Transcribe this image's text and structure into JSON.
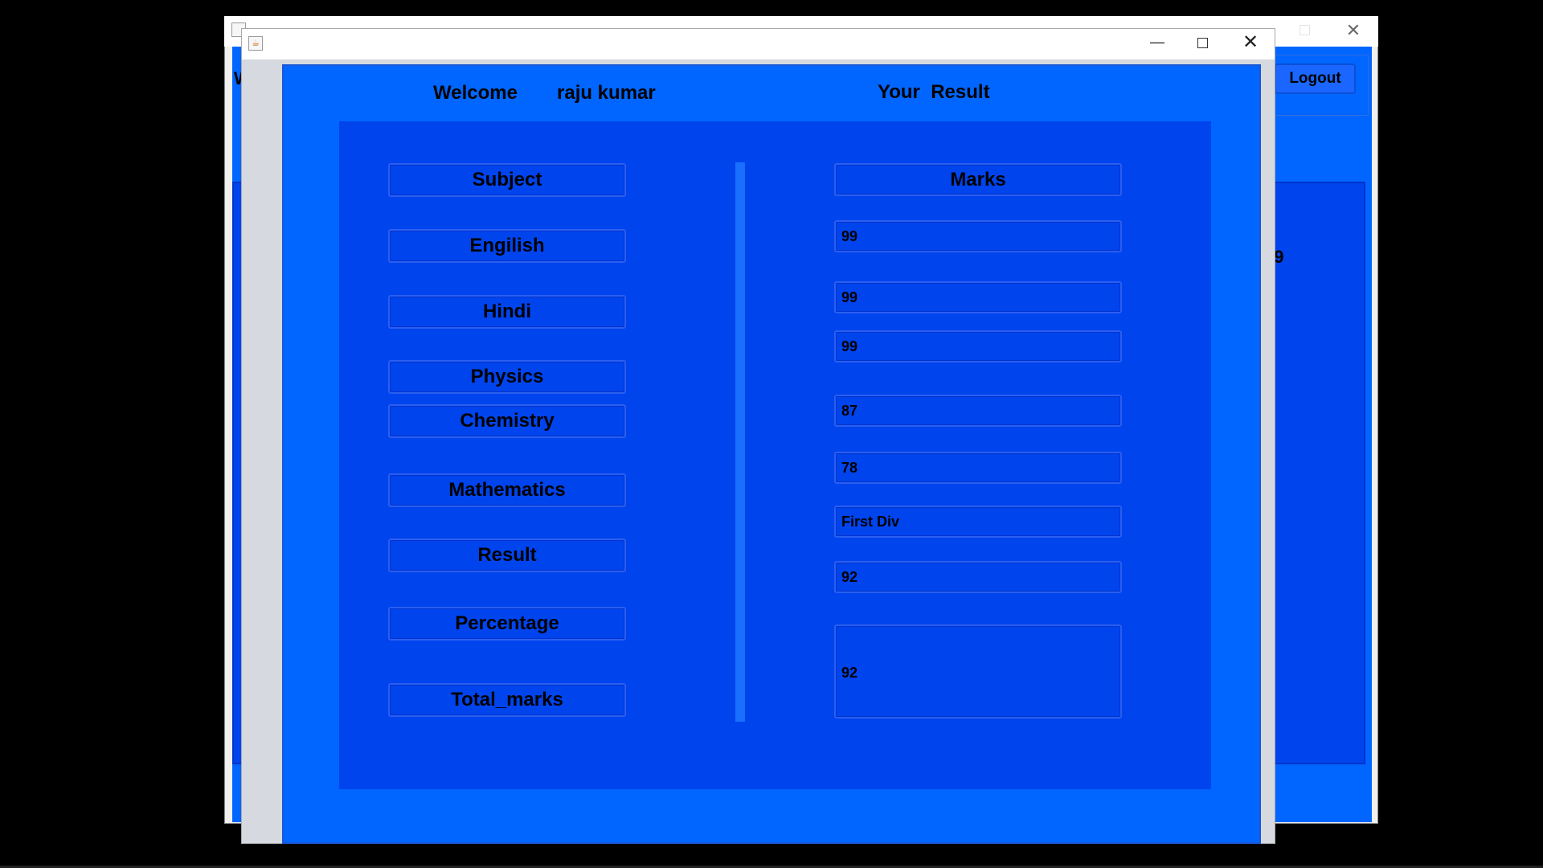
{
  "background_window": {
    "logout_label": "Logout",
    "partial_left_text": "W",
    "partial_value": "89",
    "close_glyph": "✕"
  },
  "dialog": {
    "title_icon_glyph": "☕",
    "minimize_glyph": "—",
    "close_glyph": "✕",
    "welcome_label": "Welcome",
    "user_name": "raju kumar",
    "heading": "Your  Result",
    "subjects_header": "Subject",
    "subjects": [
      "Engilish",
      "Hindi",
      "Physics",
      "Chemistry",
      "Mathematics",
      "Result",
      "Percentage",
      "Total_marks"
    ],
    "marks_header": "Marks",
    "marks": [
      "99",
      "99",
      "99",
      "87",
      "78",
      "First Div",
      "92"
    ],
    "total_marks": "92"
  },
  "colors": {
    "outer_panel": "#0066ff",
    "inner_panel": "#0044ee",
    "separator": "#1a6fff"
  }
}
